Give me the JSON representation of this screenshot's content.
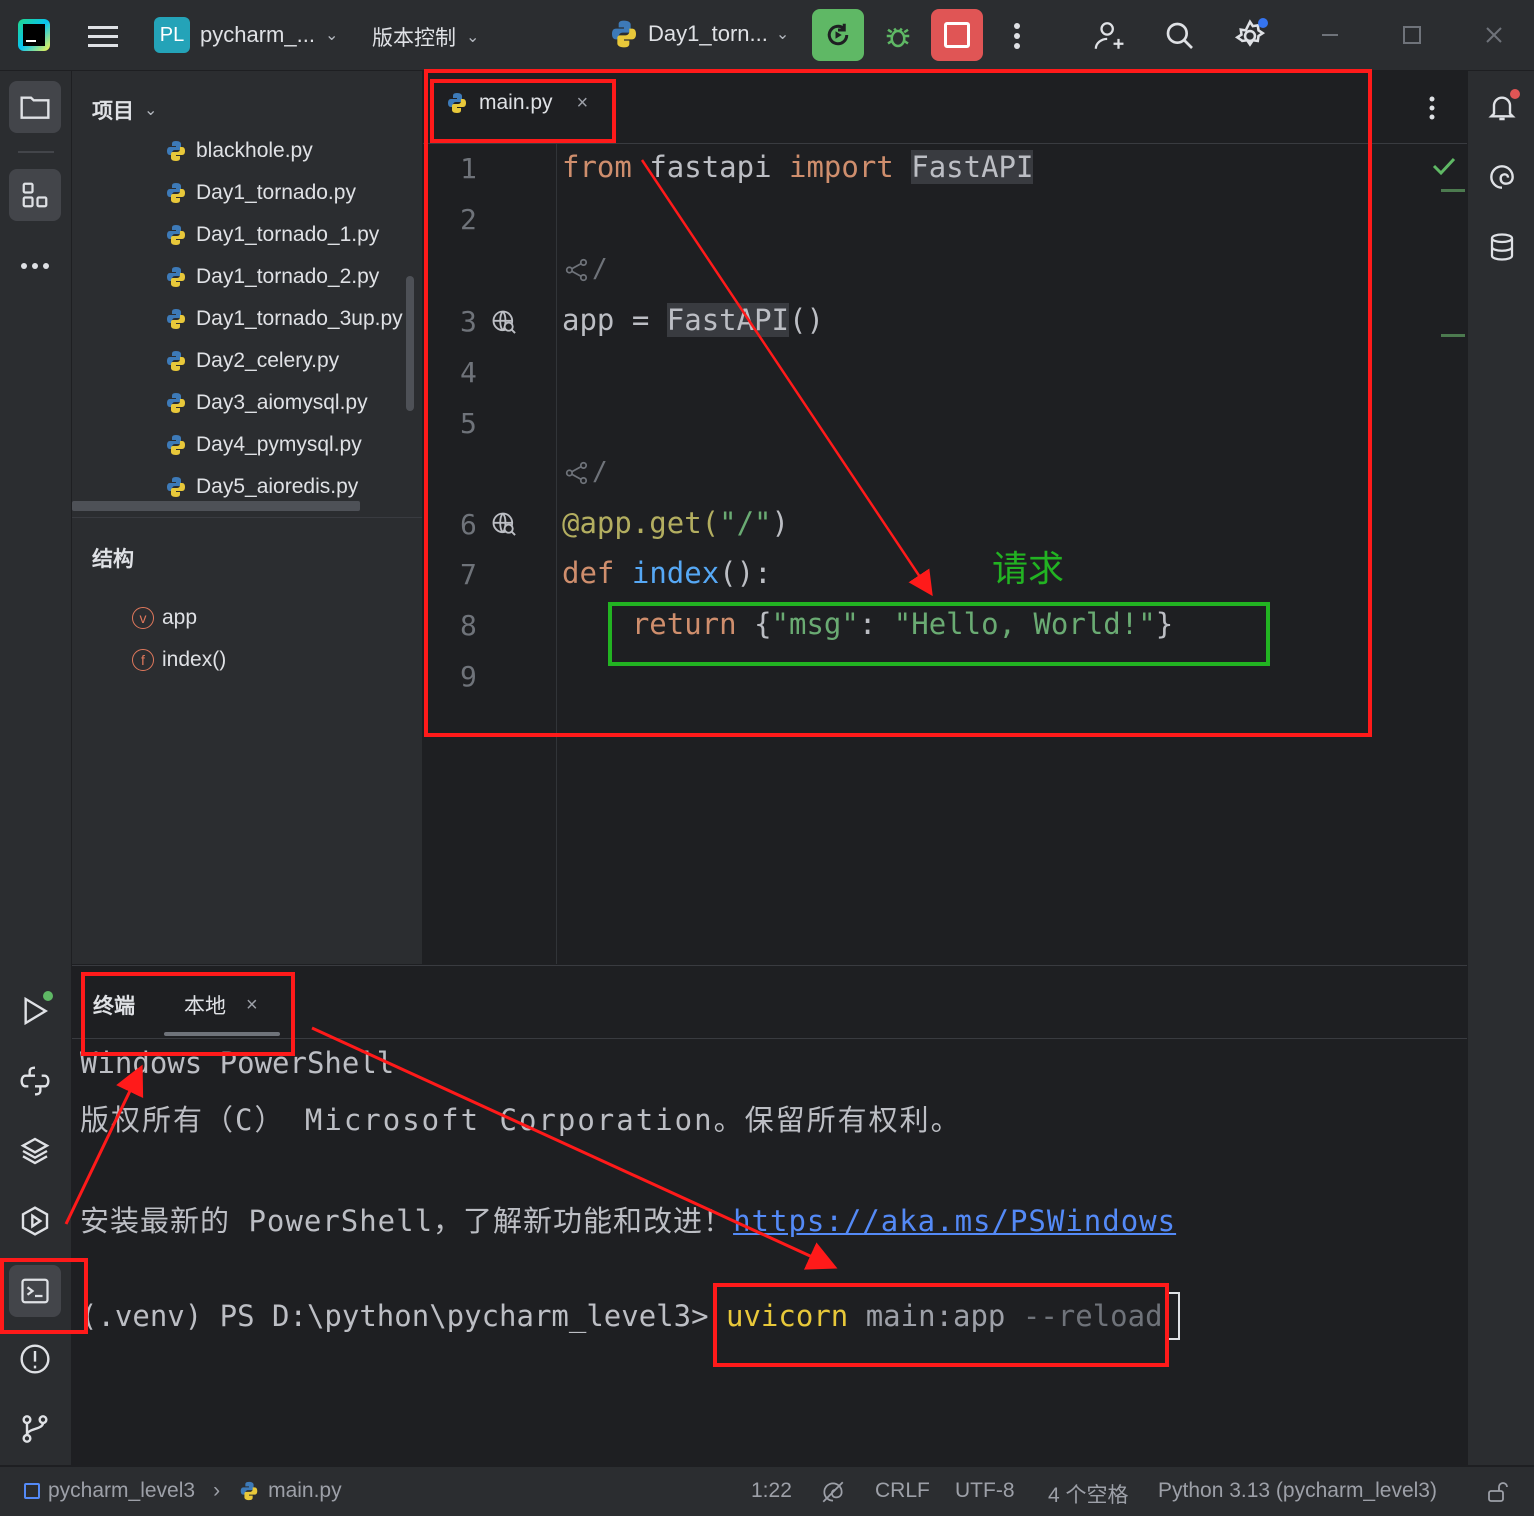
{
  "titlebar": {
    "project_badge": "PL",
    "project_name": "pycharm_...",
    "vcs_label": "版本控制",
    "run_config": "Day1_torn..."
  },
  "project_panel": {
    "title": "项目",
    "files": [
      "blackhole.py",
      "Day1_tornado.py",
      "Day1_tornado_1.py",
      "Day1_tornado_2.py",
      "Day1_tornado_3up.py",
      "Day2_celery.py",
      "Day3_aiomysql.py",
      "Day4_pymysql.py",
      "Day5_aioredis.py"
    ]
  },
  "structure_panel": {
    "title": "结构",
    "items": [
      {
        "badge": "v",
        "label": "app"
      },
      {
        "badge": "f",
        "label": "index()"
      }
    ]
  },
  "editor": {
    "tab_label": "main.py",
    "line_numbers": [
      "1",
      "2",
      "3",
      "4",
      "5",
      "6",
      "7",
      "8",
      "9"
    ],
    "code": {
      "l1_from": "from",
      "l1_module": "fastapi",
      "l1_import": "import",
      "l1_name": "FastAPI",
      "share_hint": "/",
      "l3_var": "app",
      "l3_eq": "=",
      "l3_call": "FastAPI",
      "l3_parens": "()",
      "l6_decorator": "@app.get(",
      "l6_path": "\"/\"",
      "l6_close": ")",
      "l7_def": "def",
      "l7_fn": "index",
      "l7_rest": "():",
      "l8_return": "return",
      "l8_open": "{",
      "l8_key": "\"msg\"",
      "l8_colon": ":",
      "l8_value": "\"Hello, World!\"",
      "l8_close": "}"
    },
    "annotation_label": "请求"
  },
  "terminal": {
    "title": "终端",
    "tab_label": "本地",
    "lines": {
      "l1": "Windows PowerShell",
      "l2": "版权所有（C） Microsoft Corporation。保留所有权利。",
      "l3_text": "安装最新的 PowerShell，了解新功能和改进！",
      "l3_link": "https://aka.ms/PSWindows",
      "prompt": "(.venv) PS D:\\python\\pycharm_level3>",
      "cmd_name": "uvicorn",
      "cmd_arg": "main:app",
      "cmd_hint": "--reload"
    }
  },
  "status_bar": {
    "project": "pycharm_level3",
    "file": "main.py",
    "position": "1:22",
    "line_sep": "CRLF",
    "encoding": "UTF-8",
    "indent": "4 个空格",
    "interpreter": "Python 3.13 (pycharm_level3)"
  },
  "colors": {
    "annotation_red": "#ff1a1a",
    "annotation_green": "#22b322",
    "run_button_bg": "#5fb865",
    "stop_button_bg": "#e05555"
  }
}
